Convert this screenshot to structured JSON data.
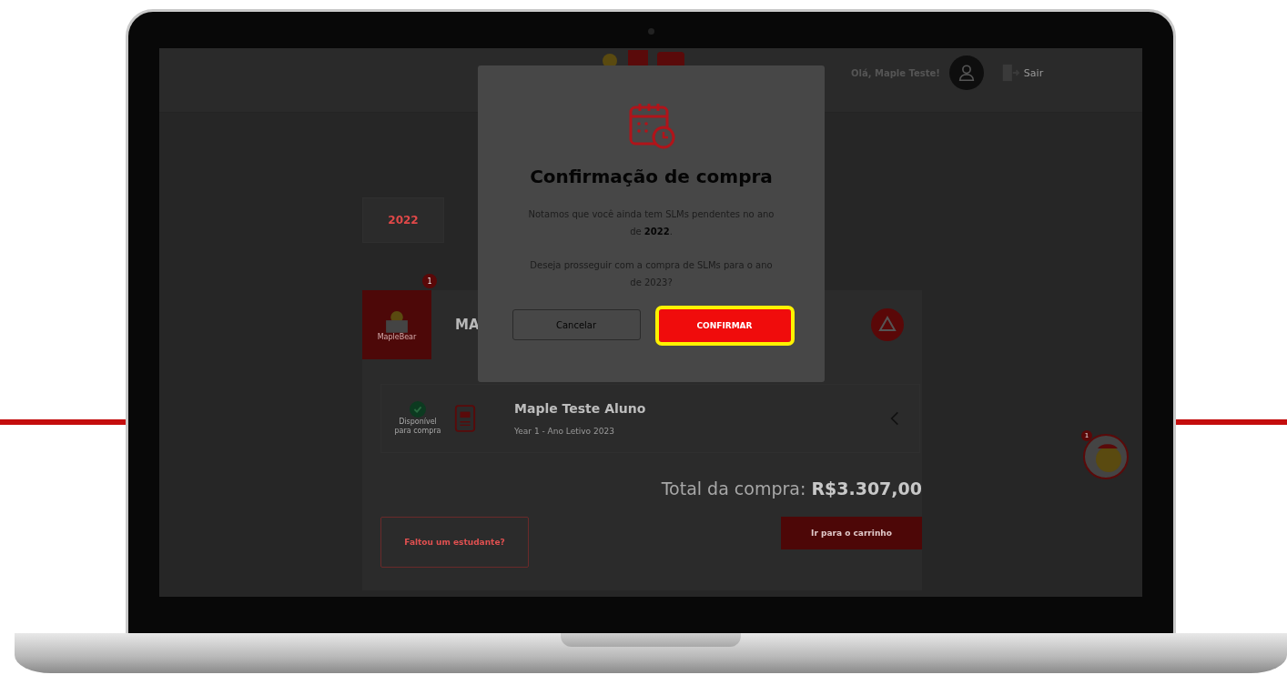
{
  "header": {
    "greeting": "Olá, Maple Teste!",
    "logout_label": "Sair"
  },
  "year_tab": {
    "label": "2022",
    "selected": true
  },
  "school_card": {
    "badge": "1",
    "logo_text": "MapleBear",
    "name": "MA"
  },
  "student": {
    "status": "Disponível para compra",
    "name": "Maple Teste Aluno",
    "detail": "Year 1 - Ano Letivo 2023"
  },
  "total": {
    "label": "Total da compra:",
    "amount": "R$3.307,00"
  },
  "buttons": [
    {
      "label": "Faltou um estudante?",
      "kind": "outline"
    },
    {
      "label": "Ir para o carrinho",
      "kind": "primary"
    }
  ],
  "chat": {
    "badge": "1"
  },
  "modal": {
    "title": "Confirmação de compra",
    "message": "Notamos que você ainda tem SLMs pendentes no ano de **2022**.",
    "question": "Deseja prosseguir com a compra de SLMs para o ano de 2023?",
    "buttons": [
      {
        "label": "Cancelar",
        "kind": "secondary",
        "highlighted": false
      },
      {
        "label": "CONFIRMAR",
        "kind": "primary",
        "highlighted": true
      }
    ]
  }
}
